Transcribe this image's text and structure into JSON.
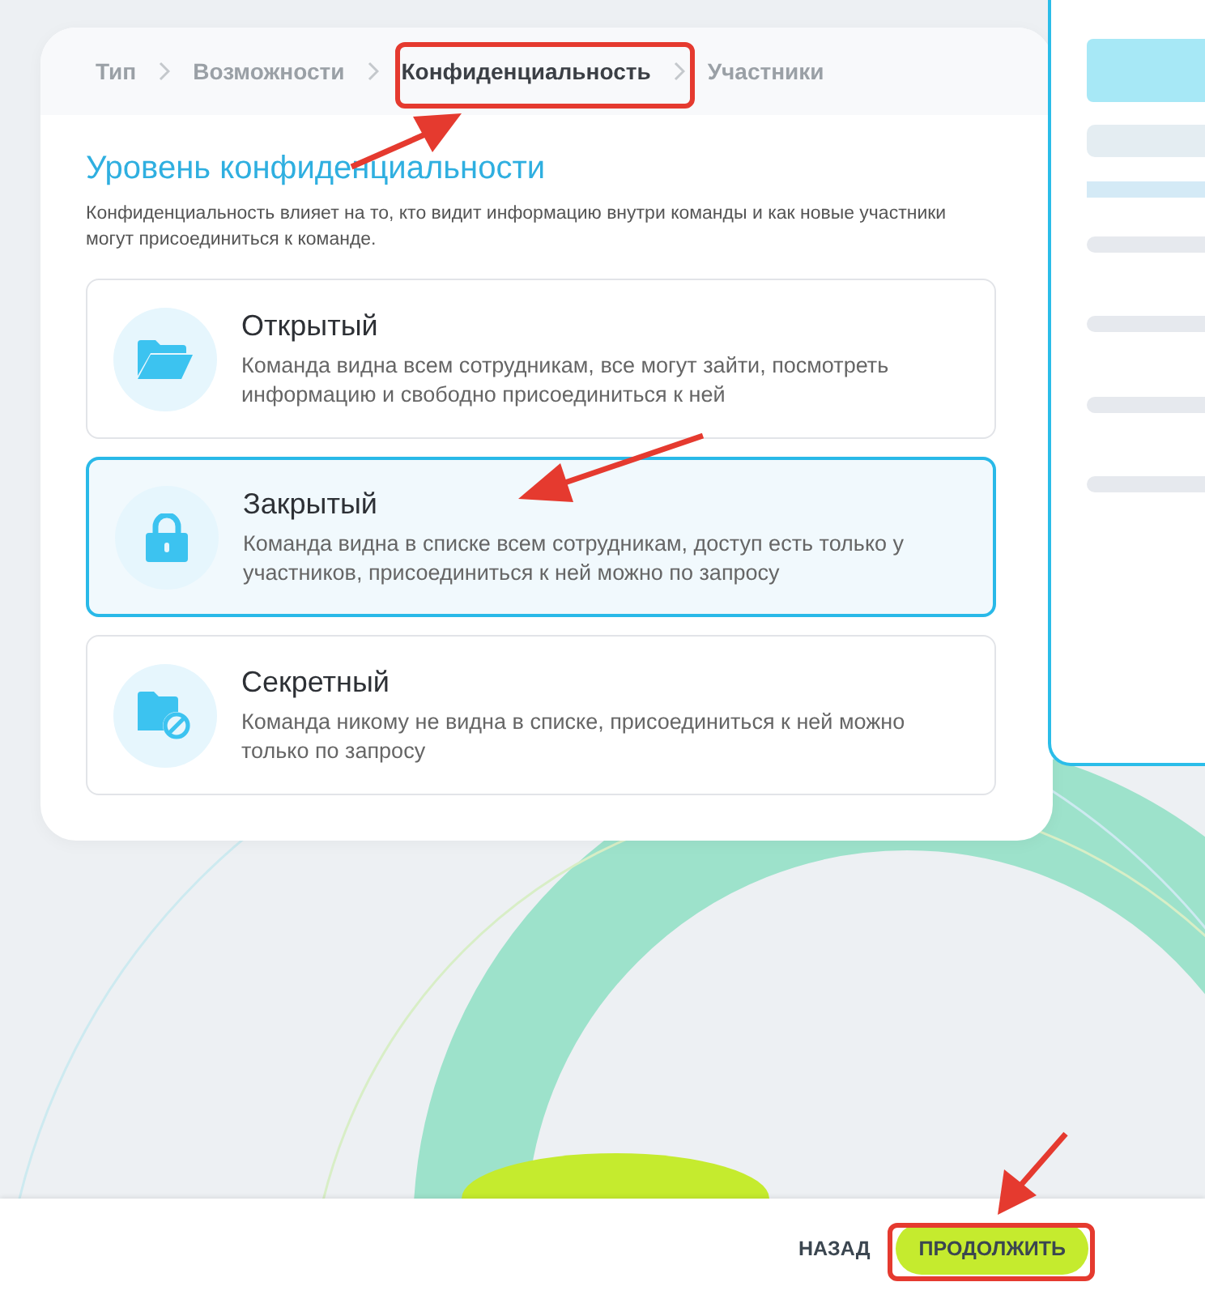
{
  "breadcrumb": [
    {
      "label": "Тип",
      "selected": false
    },
    {
      "label": "Возможности",
      "selected": false
    },
    {
      "label": "Конфиденциальность",
      "selected": true
    },
    {
      "label": "Участники",
      "selected": false
    }
  ],
  "heading": "Уровень конфиденциальности",
  "description": "Конфиденциальность влияет на то, кто видит информацию внутри команды и как новые участники могут присоединиться к команде.",
  "options": [
    {
      "kind": "folder",
      "title": "Открытый",
      "text": "Команда видна всем сотрудникам, все могут зайти, посмотреть информацию и свободно присоединиться к ней",
      "selected": false
    },
    {
      "kind": "lock",
      "title": "Закрытый",
      "text": "Команда видна в списке всем сотрудникам, доступ есть только у участников, присоединиться к ней можно по запросу",
      "selected": true
    },
    {
      "kind": "hidden",
      "title": "Секретный",
      "text": "Команда никому не видна в списке, присоединиться к ней можно только по запросу",
      "selected": false
    }
  ],
  "buttons": [
    {
      "kind": "back",
      "label": "НАЗАД"
    },
    {
      "kind": "next",
      "label": "ПРОДОЛЖИТЬ"
    }
  ]
}
